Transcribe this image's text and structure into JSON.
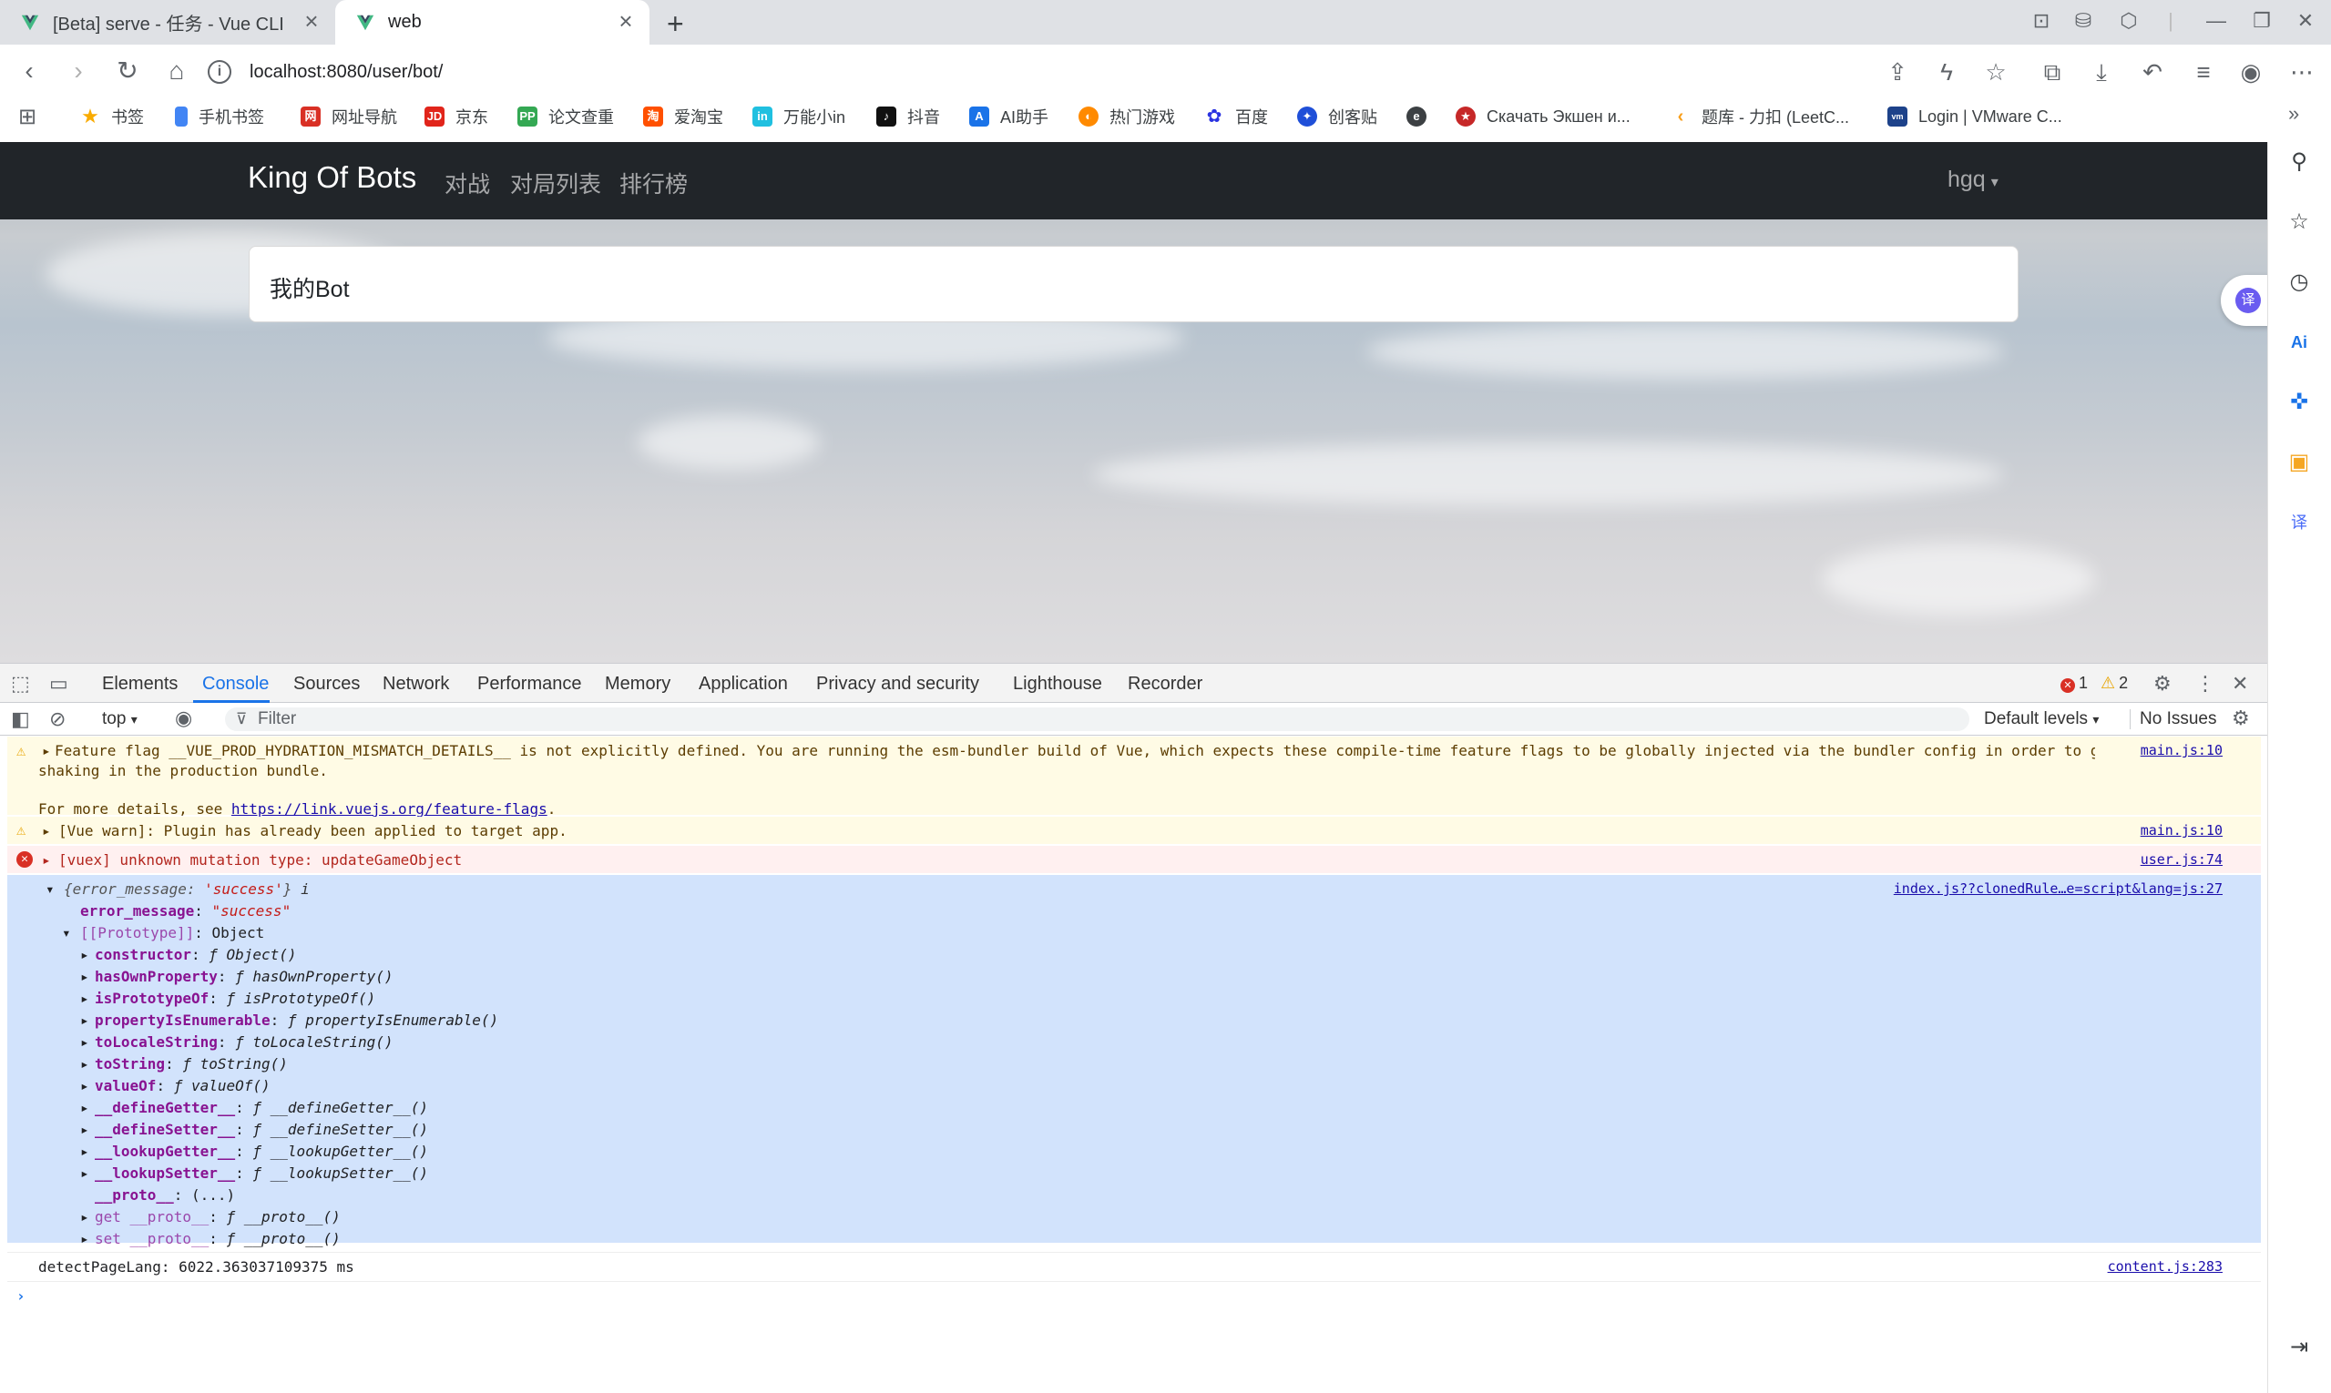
{
  "browser": {
    "tabs": [
      {
        "title": "[Beta] serve - 任务 - Vue CLI",
        "active": false
      },
      {
        "title": "web",
        "active": true
      }
    ],
    "url": "localhost:8080/user/bot/",
    "bookmarks": [
      {
        "label": "书签",
        "icon": "star-icon",
        "color": "#f9ab00"
      },
      {
        "label": "手机书签",
        "icon": "phone-bookmark-icon",
        "color": "#4285f4"
      },
      {
        "label": "网址导航",
        "icon": "nav-icon",
        "color": "#d93025"
      },
      {
        "label": "京东",
        "icon": "jd-icon",
        "color": "#e1251b"
      },
      {
        "label": "论文查重",
        "icon": "pp-icon",
        "color": "#34a853"
      },
      {
        "label": "爱淘宝",
        "icon": "taobao-icon",
        "color": "#ff5000"
      },
      {
        "label": "万能小in",
        "icon": "wanneng-icon",
        "color": "#20c0e0"
      },
      {
        "label": "抖音",
        "icon": "douyin-icon",
        "color": "#111111"
      },
      {
        "label": "AI助手",
        "icon": "ai-icon",
        "color": "#1a73e8"
      },
      {
        "label": "热门游戏",
        "icon": "game-icon",
        "color": "#ff8a00"
      },
      {
        "label": "百度",
        "icon": "baidu-icon",
        "color": "#2932e1"
      },
      {
        "label": "创客贴",
        "icon": "chuangke-icon",
        "color": "#1f4fd8"
      },
      {
        "label": "",
        "icon": "edge-icon",
        "color": "#3c4043"
      },
      {
        "label": "Скачать Экшен и...",
        "icon": "emblem-icon",
        "color": "#c62828"
      },
      {
        "label": "题库 - 力扣 (LeetC...",
        "icon": "leetcode-icon",
        "color": "#f89f1b"
      },
      {
        "label": "Login | VMware C...",
        "icon": "vmware-icon",
        "color": "#1d428a"
      }
    ]
  },
  "app": {
    "brand": "King Of Bots",
    "nav": [
      "对战",
      "对局列表",
      "排行榜"
    ],
    "user": "hgq",
    "card_title": "我的Bot"
  },
  "devtools": {
    "tabs": [
      "Elements",
      "Console",
      "Sources",
      "Network",
      "Performance",
      "Memory",
      "Application",
      "Privacy and security",
      "Lighthouse",
      "Recorder"
    ],
    "error_count": "1",
    "warning_count": "2",
    "context": "top",
    "filter_placeholder": "Filter",
    "levels": "Default levels",
    "issues": "No Issues",
    "messages": {
      "m1_line1": "Feature flag __VUE_PROD_HYDRATION_MISMATCH_DETAILS__ is not explicitly defined. You are running the esm-bundler build of Vue, which expects these compile-time feature flags to be globally injected via the bundler config in order to get better tree-",
      "m1_line2": "shaking in the production bundle.",
      "m1_more": "For more details, see ",
      "m1_link": "https://link.vuejs.org/feature-flags",
      "m1_end": ".",
      "m1_src": "main.js:10",
      "m2": "[Vue warn]: Plugin has already been applied to target app.",
      "m2_src": "main.js:10",
      "m3": "[vuex] unknown mutation type: updateGameObject",
      "m3_src": "user.js:74",
      "obj_summary_pre": "{error_message: ",
      "obj_summary_val": "'success'",
      "obj_summary_post": "} ",
      "obj_info": "i",
      "obj_src": "index.js??clonedRule…e=script&lang=js:27",
      "obj_key": "error_message",
      "obj_val": "\"success\"",
      "proto_key": "[[Prototype]]",
      "proto_val": "Object",
      "proto_entries": [
        {
          "key": "constructor",
          "val": "ƒ Object()"
        },
        {
          "key": "hasOwnProperty",
          "val": "ƒ hasOwnProperty()"
        },
        {
          "key": "isPrototypeOf",
          "val": "ƒ isPrototypeOf()"
        },
        {
          "key": "propertyIsEnumerable",
          "val": "ƒ propertyIsEnumerable()"
        },
        {
          "key": "toLocaleString",
          "val": "ƒ toLocaleString()"
        },
        {
          "key": "toString",
          "val": "ƒ toString()"
        },
        {
          "key": "valueOf",
          "val": "ƒ valueOf()"
        },
        {
          "key": "__defineGetter__",
          "val": "ƒ __defineGetter__()"
        },
        {
          "key": "__defineSetter__",
          "val": "ƒ __defineSetter__()"
        },
        {
          "key": "__lookupGetter__",
          "val": "ƒ __lookupGetter__()"
        },
        {
          "key": "__lookupSetter__",
          "val": "ƒ __lookupSetter__()"
        },
        {
          "key": "__proto__",
          "val": "(...)"
        },
        {
          "key": "get __proto__",
          "val": "ƒ __proto__()"
        },
        {
          "key": "set __proto__",
          "val": "ƒ __proto__()"
        }
      ],
      "m5": "detectPageLang: 6022.363037109375 ms",
      "m5_src": "content.js:283"
    }
  }
}
